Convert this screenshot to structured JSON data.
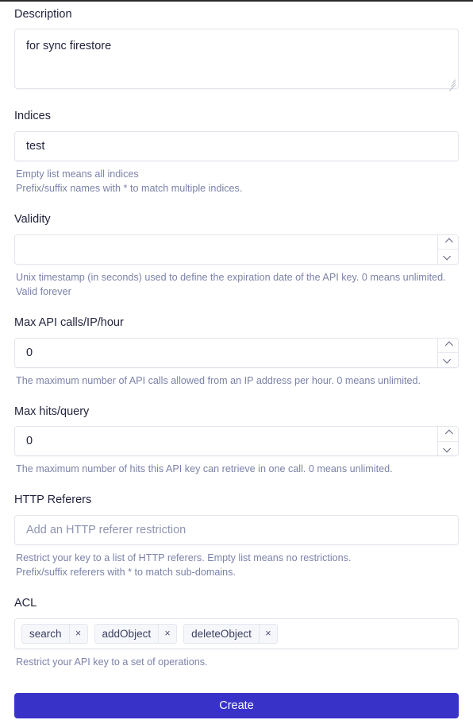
{
  "form": {
    "description": {
      "label": "Description",
      "value": "for sync firestore"
    },
    "indices": {
      "label": "Indices",
      "value": "test",
      "help_line_1": "Empty list means all indices",
      "help_line_2": "Prefix/suffix names with * to match multiple indices."
    },
    "validity": {
      "label": "Validity",
      "value": "",
      "help_line_1": "Unix timestamp (in seconds) used to define the expiration date of the API key. 0 means unlimited.",
      "help_line_2": "Valid forever"
    },
    "max_api_calls": {
      "label": "Max API calls/IP/hour",
      "value": "0",
      "help_line_1": "The maximum number of API calls allowed from an IP address per hour. 0 means unlimited."
    },
    "max_hits": {
      "label": "Max hits/query",
      "value": "0",
      "help_line_1": "The maximum number of hits this API key can retrieve in one call. 0 means unlimited."
    },
    "http_referers": {
      "label": "HTTP Referers",
      "placeholder": "Add an HTTP referer restriction",
      "help_line_1": "Restrict your key to a list of HTTP referers. Empty list means no restrictions.",
      "help_line_2": "Prefix/suffix referers with * to match sub-domains."
    },
    "acl": {
      "label": "ACL",
      "tags": [
        {
          "label": "search",
          "remove_icon": "×"
        },
        {
          "label": "addObject",
          "remove_icon": "×"
        },
        {
          "label": "deleteObject",
          "remove_icon": "×"
        }
      ],
      "help_line_1": "Restrict your API key to a set of operations."
    },
    "submit": {
      "label": "Create"
    }
  },
  "colors": {
    "accent": "#3832c8",
    "label_text": "#21243d",
    "help_text": "#7b82a8",
    "border": "#e2e5ec",
    "placeholder": "#8f95b2",
    "tag_bg": "#f6f7fa"
  }
}
